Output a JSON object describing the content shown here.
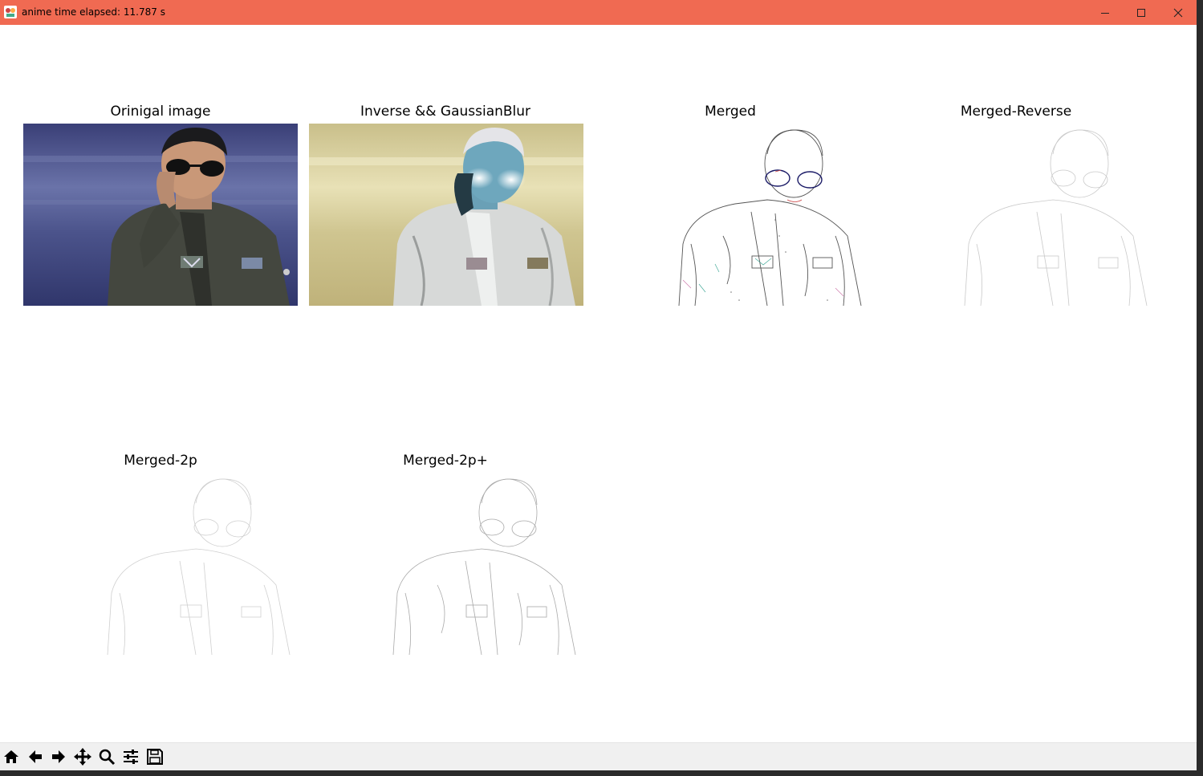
{
  "window": {
    "title": "anime time elapsed: 11.787 s",
    "accent": "#f06a52"
  },
  "figure": {
    "subplots": [
      {
        "title": "Orinigal image",
        "kind": "photo-original"
      },
      {
        "title": "Inverse && GaussianBlur",
        "kind": "photo-inverse-blur"
      },
      {
        "title": "Merged",
        "kind": "sketch-color"
      },
      {
        "title": "Merged-Reverse",
        "kind": "sketch-faint"
      },
      {
        "title": "Merged-2p",
        "kind": "sketch-faint"
      },
      {
        "title": "Merged-2p+",
        "kind": "sketch-light"
      }
    ]
  },
  "toolbar": {
    "tools": [
      "home-icon",
      "back-arrow-icon",
      "forward-arrow-icon",
      "pan-icon",
      "zoom-icon",
      "configure-subplots-icon",
      "save-icon"
    ]
  }
}
